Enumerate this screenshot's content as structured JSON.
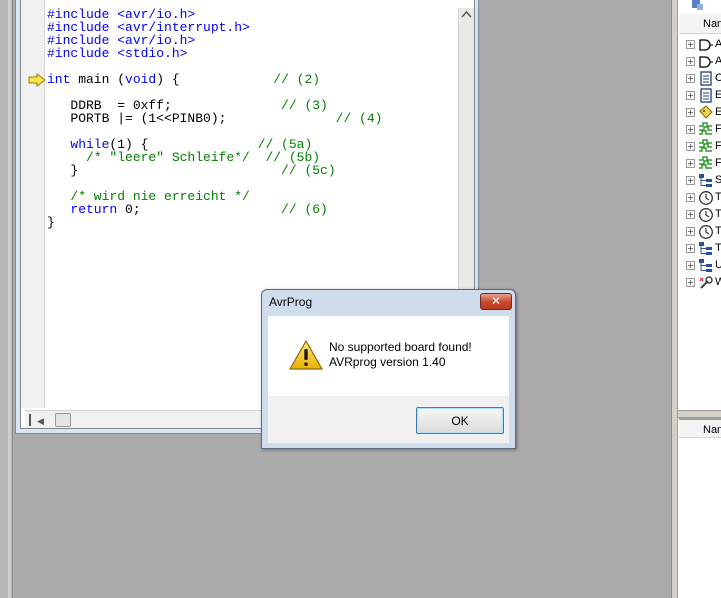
{
  "editor": {
    "code_lines": [
      [
        {
          "t": "#include <avr/io.h>",
          "c": "kw"
        }
      ],
      [
        {
          "t": "#include <avr/interrupt.h>",
          "c": "kw"
        }
      ],
      [
        {
          "t": "#include <avr/io.h>",
          "c": "kw"
        }
      ],
      [
        {
          "t": "#include <stdio.h>",
          "c": "kw"
        }
      ],
      [],
      [
        {
          "t": "int",
          "c": "kw"
        },
        {
          "t": " main (",
          "c": ""
        },
        {
          "t": "void",
          "c": "kw"
        },
        {
          "t": ") {            ",
          "c": ""
        },
        {
          "t": "// (2)",
          "c": "cm"
        }
      ],
      [],
      [
        {
          "t": "   DDRB  = 0xff;              ",
          "c": ""
        },
        {
          "t": "// (3)",
          "c": "cm"
        }
      ],
      [
        {
          "t": "   PORTB |= (1<<PINB0);              ",
          "c": ""
        },
        {
          "t": "// (4)",
          "c": "cm"
        }
      ],
      [],
      [
        {
          "t": "   ",
          "c": ""
        },
        {
          "t": "while",
          "c": "kw"
        },
        {
          "t": "(1) {              ",
          "c": ""
        },
        {
          "t": "// (5a)",
          "c": "cm"
        }
      ],
      [
        {
          "t": "     ",
          "c": ""
        },
        {
          "t": "/* \"leere\" Schleife*/  // (5b)",
          "c": "cm"
        }
      ],
      [
        {
          "t": "   }                          ",
          "c": ""
        },
        {
          "t": "// (5c)",
          "c": "cm"
        }
      ],
      [],
      [
        {
          "t": "   ",
          "c": ""
        },
        {
          "t": "/* wird nie erreicht */",
          "c": "cm"
        }
      ],
      [
        {
          "t": "   ",
          "c": ""
        },
        {
          "t": "return",
          "c": "kw"
        },
        {
          "t": " 0;                  ",
          "c": ""
        },
        {
          "t": "// (6)",
          "c": "cm"
        }
      ],
      [
        {
          "t": "}",
          "c": ""
        }
      ]
    ],
    "current_line_marker": "arrow-icon"
  },
  "right_panel": {
    "header_label": "Nam",
    "bottom_header_label": "Nam",
    "tree_items": [
      {
        "icon": "gate-icon",
        "label": "A",
        "color": "#000000"
      },
      {
        "icon": "gate-icon",
        "label": "A",
        "color": "#000000"
      },
      {
        "icon": "document-icon",
        "label": "C",
        "color": "#000000"
      },
      {
        "icon": "document-icon",
        "label": "E",
        "color": "#000000"
      },
      {
        "icon": "tag-icon",
        "label": "E",
        "color": "#000000"
      },
      {
        "icon": "signal-icon",
        "label": "F",
        "color": "#2e9a2e"
      },
      {
        "icon": "signal-icon",
        "label": "F",
        "color": "#2e9a2e"
      },
      {
        "icon": "signal-icon",
        "label": "F",
        "color": "#2e9a2e"
      },
      {
        "icon": "tree-icon",
        "label": "S",
        "color": "#000000"
      },
      {
        "icon": "clock-icon",
        "label": "T",
        "color": "#000000"
      },
      {
        "icon": "clock-icon",
        "label": "T",
        "color": "#000000"
      },
      {
        "icon": "clock-icon",
        "label": "T",
        "color": "#000000"
      },
      {
        "icon": "tree-icon",
        "label": "T",
        "color": "#000000"
      },
      {
        "icon": "tree-icon",
        "label": "U",
        "color": "#000000"
      },
      {
        "icon": "wrench-icon",
        "label": "W",
        "color": "#000000"
      }
    ]
  },
  "dialog": {
    "title": "AvrProg",
    "close_label": "✕",
    "message_line1": "No supported board found!",
    "message_line2": "AVRprog version 1.40",
    "ok_label": "OK",
    "icon": "warning-icon"
  },
  "colors": {
    "keyword": "#0000ff",
    "comment": "#008000",
    "desktop": "#ababab"
  }
}
